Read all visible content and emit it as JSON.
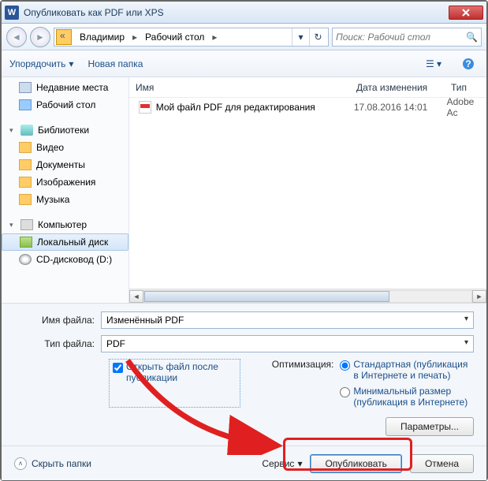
{
  "titlebar": {
    "title": "Опубликовать как PDF или XPS"
  },
  "breadcrumb": {
    "p1": "Владимир",
    "p2": "Рабочий стол"
  },
  "search": {
    "placeholder": "Поиск: Рабочий стол"
  },
  "toolbar": {
    "organize": "Упорядочить",
    "newfolder": "Новая папка"
  },
  "sidebar": {
    "recent": "Недавние места",
    "desktop": "Рабочий стол",
    "libs": "Библиотеки",
    "video": "Видео",
    "docs": "Документы",
    "images": "Изображения",
    "music": "Музыка",
    "computer": "Компьютер",
    "localdisk": "Локальный диск",
    "cddrive": "CD-дисковод (D:)"
  },
  "columns": {
    "name": "Имя",
    "date": "Дата изменения",
    "type": "Тип"
  },
  "file": {
    "name": "Мой файл PDF для редактирования",
    "date": "17.08.2016 14:01",
    "type": "Adobe Ac"
  },
  "form": {
    "filename_label": "Имя файла:",
    "filename_value": "Изменённый PDF",
    "filetype_label": "Тип файла:",
    "filetype_value": "PDF",
    "openafter": "Открыть файл после публикации",
    "optim_label": "Оптимизация:",
    "radio_standard": "Стандартная (публикация в Интернете и печать)",
    "radio_min": "Минимальный размер (публикация в Интернете)",
    "params": "Параметры..."
  },
  "footer": {
    "hide": "Скрыть папки",
    "service": "Сервис",
    "publish": "Опубликовать",
    "cancel": "Отмена"
  }
}
